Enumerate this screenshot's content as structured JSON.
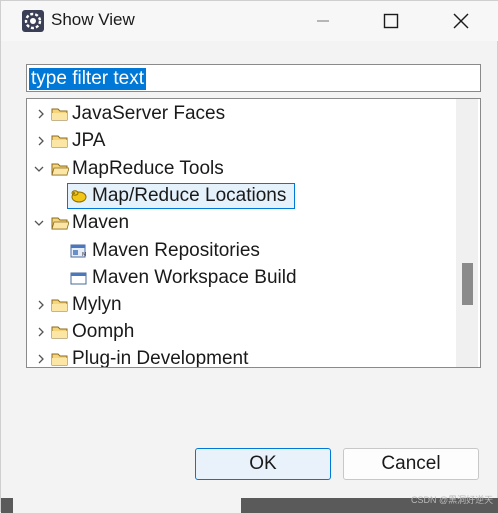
{
  "window": {
    "title": "Show View",
    "minimize_icon": "minimize-icon",
    "maximize_icon": "maximize-icon",
    "close_icon": "close-icon"
  },
  "filter": {
    "value": "type filter text"
  },
  "tree": {
    "items": [
      {
        "label": "JavaServer Faces",
        "level": 0,
        "expanded": false,
        "icon": "folder-icon"
      },
      {
        "label": "JPA",
        "level": 0,
        "expanded": false,
        "icon": "folder-icon"
      },
      {
        "label": "MapReduce Tools",
        "level": 0,
        "expanded": true,
        "icon": "folder-icon"
      },
      {
        "label": "Map/Reduce Locations",
        "level": 1,
        "selected": true,
        "icon": "mapreduce-icon"
      },
      {
        "label": "Maven",
        "level": 0,
        "expanded": true,
        "icon": "folder-icon"
      },
      {
        "label": "Maven Repositories",
        "level": 1,
        "icon": "maven-repo-icon"
      },
      {
        "label": "Maven Workspace Build",
        "level": 1,
        "icon": "view-window-icon"
      },
      {
        "label": "Mylyn",
        "level": 0,
        "expanded": false,
        "icon": "folder-icon"
      },
      {
        "label": "Oomph",
        "level": 0,
        "expanded": false,
        "icon": "folder-icon"
      },
      {
        "label": "Plug-in Development",
        "level": 0,
        "expanded": false,
        "icon": "folder-icon"
      }
    ]
  },
  "buttons": {
    "ok": "OK",
    "cancel": "Cancel"
  },
  "watermark": "CSDN @黑洞好逆天"
}
